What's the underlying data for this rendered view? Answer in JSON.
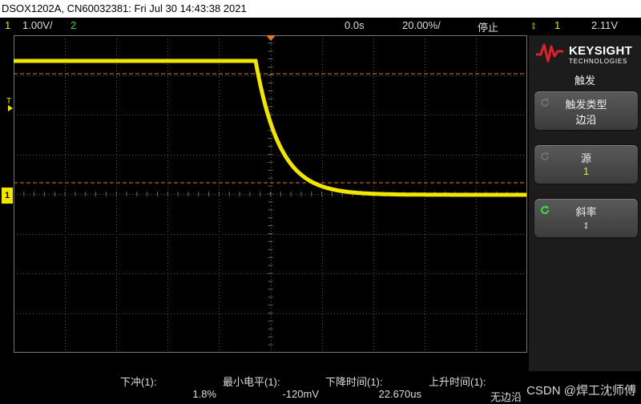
{
  "title_bar": {
    "text": "DSOX1202A, CN60032381: Fri Jul 30 14:43:38 2021"
  },
  "status": {
    "ch1_number": "1",
    "ch1_scale": "1.00V/",
    "ch2_number": "2",
    "time_delay": "0.0s",
    "time_scale": "20.00%/",
    "run_state": "停止",
    "trigger_slope_symbol": "⦂",
    "trigger_source": "1",
    "trigger_level": "2.11V"
  },
  "plot": {
    "trigger_marker": "T",
    "ground_marker": "1"
  },
  "brand": {
    "name": "KEYSIGHT",
    "sub": "TECHNOLOGIES"
  },
  "menu": {
    "title": "触发",
    "softkeys": [
      {
        "title": "触发类型",
        "value": "边沿"
      },
      {
        "title": "源",
        "value": "1"
      },
      {
        "title": "斜率",
        "value": "⦂"
      }
    ]
  },
  "measurements": [
    {
      "label": "下冲(1):",
      "value": "1.8%"
    },
    {
      "label": "最小电平(1):",
      "value": "-120mV"
    },
    {
      "label": "下降时间(1):",
      "value": "22.670us"
    },
    {
      "label": "上升时间(1):",
      "value": "无边沿"
    }
  ],
  "watermark": "CSDN @焊工沈师傅",
  "colors": {
    "ch1": "#f2e600",
    "ch2": "#3ddc3d",
    "grid": "#666666",
    "cursor": "#e07a2a"
  }
}
